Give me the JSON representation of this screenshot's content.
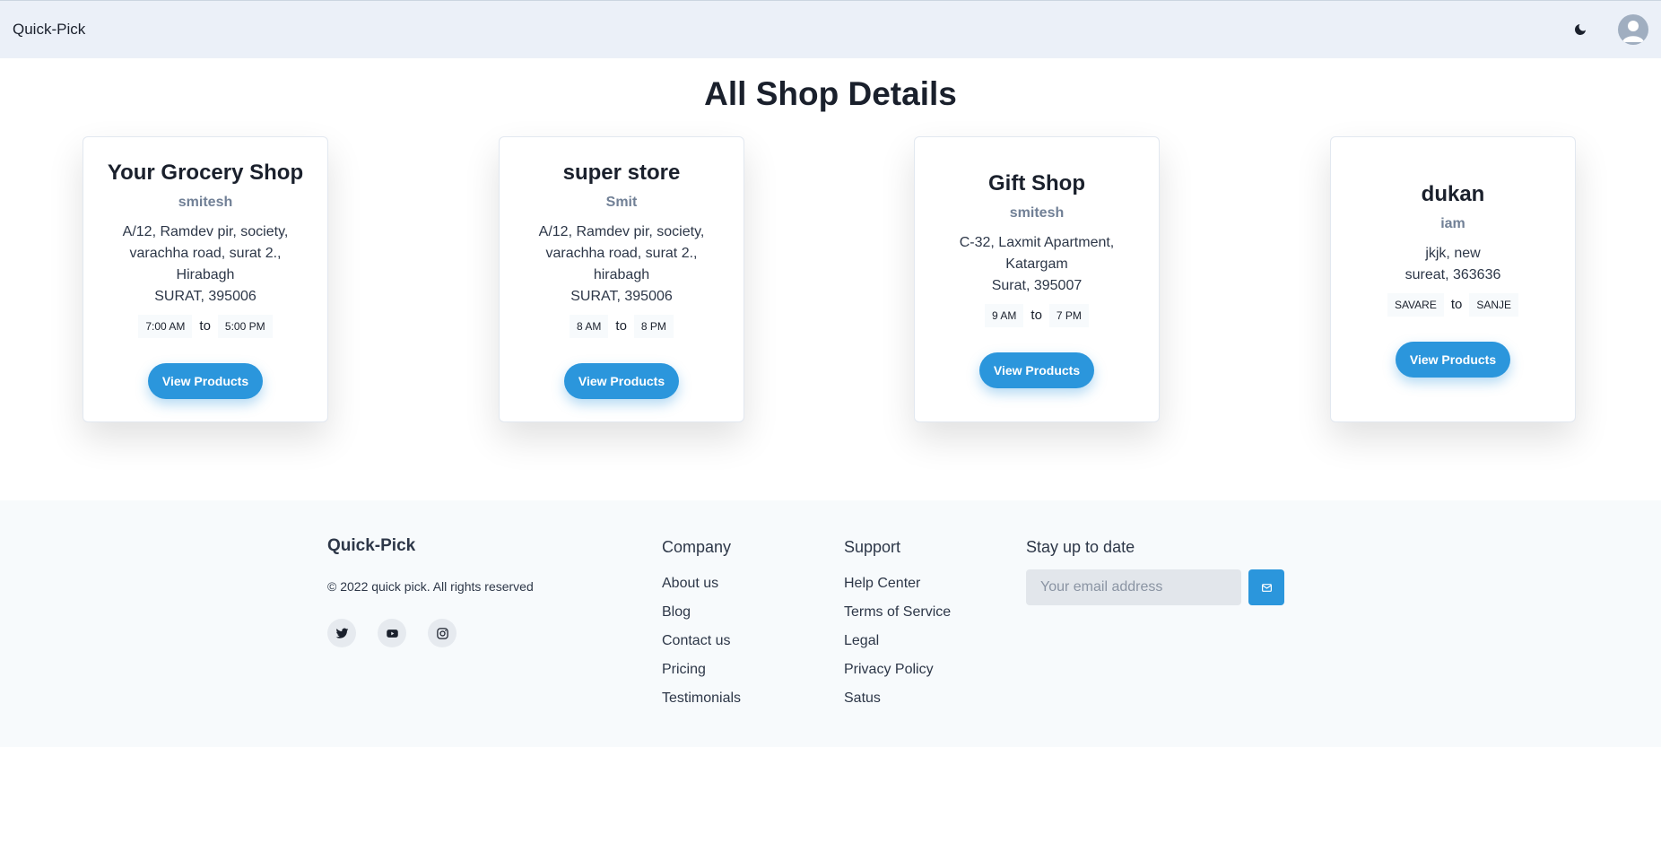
{
  "navbar": {
    "brand": "Quick-Pick",
    "theme_icon": "moon-icon",
    "avatar_icon": "user-avatar-icon"
  },
  "page": {
    "title": "All Shop Details"
  },
  "shops": [
    {
      "name": "Your Grocery Shop",
      "owner": "smitesh",
      "address_lines": [
        "A/12, Ramdev pir, society,",
        "varachha road, surat 2.,",
        "Hirabagh",
        "SURAT, 395006"
      ],
      "open": "7:00 AM",
      "to": "to",
      "close": "5:00 PM",
      "button": "View Products"
    },
    {
      "name": "super store",
      "owner": "Smit",
      "address_lines": [
        "A/12, Ramdev pir, society,",
        "varachha road, surat 2.,",
        "hirabagh",
        "SURAT, 395006"
      ],
      "open": "8 AM",
      "to": "to",
      "close": "8 PM",
      "button": "View Products"
    },
    {
      "name": "Gift Shop",
      "owner": "smitesh",
      "address_lines": [
        "C-32, Laxmit Apartment,",
        "Katargam",
        "Surat, 395007"
      ],
      "open": "9 AM",
      "to": "to",
      "close": "7 PM",
      "button": "View Products"
    },
    {
      "name": "dukan",
      "owner": "iam",
      "address_lines": [
        "jkjk, new",
        "sureat, 363636"
      ],
      "open": "SAVARE",
      "to": "to",
      "close": "SANJE",
      "button": "View Products"
    }
  ],
  "footer": {
    "brand": "Quick-Pick",
    "copyright": "© 2022 quick pick. All rights reserved",
    "socials": [
      "twitter-icon",
      "youtube-icon",
      "instagram-icon"
    ],
    "company": {
      "heading": "Company",
      "links": [
        "About us",
        "Blog",
        "Contact us",
        "Pricing",
        "Testimonials"
      ]
    },
    "support": {
      "heading": "Support",
      "links": [
        "Help Center",
        "Terms of Service",
        "Legal",
        "Privacy Policy",
        "Satus"
      ]
    },
    "newsletter": {
      "heading": "Stay up to date",
      "placeholder": "Your email address",
      "button_icon": "send-mail-icon"
    }
  },
  "colors": {
    "navbar_bg": "#ebf0f8",
    "accent": "#2b96dc",
    "footer_bg": "#f7fafc"
  }
}
